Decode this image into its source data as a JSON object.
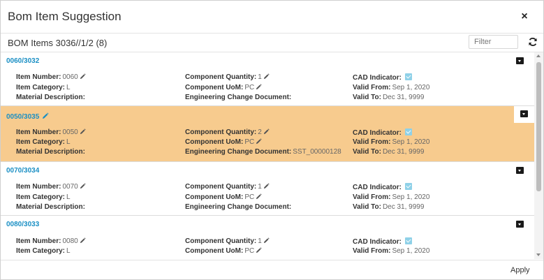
{
  "dialog": {
    "title": "Bom Item Suggestion",
    "close_label": "×",
    "subtitle": "BOM Items 3036//1/2 (8)",
    "filter_placeholder": "Filter",
    "apply_label": "Apply"
  },
  "labels": {
    "item_number": "Item Number:",
    "item_category": "Item Category:",
    "material_description": "Material Description:",
    "component_quantity": "Component Quantity:",
    "component_uom": "Component UoM:",
    "engineering_change_document": "Engineering Change Document:",
    "cad_indicator": "CAD Indicator:",
    "valid_from": "Valid From:",
    "valid_to": "Valid To:"
  },
  "items": [
    {
      "header": "0060/3032",
      "item_number": "0060",
      "item_category": "L",
      "material_description": "",
      "component_quantity": "1",
      "component_uom": "PC",
      "engineering_change_document": "",
      "cad_indicator": true,
      "valid_from": "Sep 1, 2020",
      "valid_to": "Dec 31, 9999"
    },
    {
      "header": "0050/3035",
      "item_number": "0050",
      "item_category": "L",
      "material_description": "",
      "component_quantity": "2",
      "component_uom": "PC",
      "engineering_change_document": "SST_00000128",
      "cad_indicator": true,
      "valid_from": "Sep 1, 2020",
      "valid_to": "Dec 31, 9999"
    },
    {
      "header": "0070/3034",
      "item_number": "0070",
      "item_category": "L",
      "material_description": "",
      "component_quantity": "1",
      "component_uom": "PC",
      "engineering_change_document": "",
      "cad_indicator": true,
      "valid_from": "Sep 1, 2020",
      "valid_to": "Dec 31, 9999"
    },
    {
      "header": "0080/3033",
      "item_number": "0080",
      "item_category": "L",
      "material_description": "",
      "component_quantity": "1",
      "component_uom": "PC",
      "engineering_change_document": "",
      "cad_indicator": true,
      "valid_from": "Sep 1, 2020",
      "valid_to": ""
    }
  ],
  "colors": {
    "highlight": "#f7cb8e",
    "link": "#1a8fc4",
    "checkbox": "#8fd1e8"
  },
  "icons": {
    "close": "close-icon",
    "refresh": "refresh-icon",
    "edit": "pencil-icon",
    "collapse": "chevron-down-icon",
    "checkbox": "checkbox-checked-icon"
  }
}
